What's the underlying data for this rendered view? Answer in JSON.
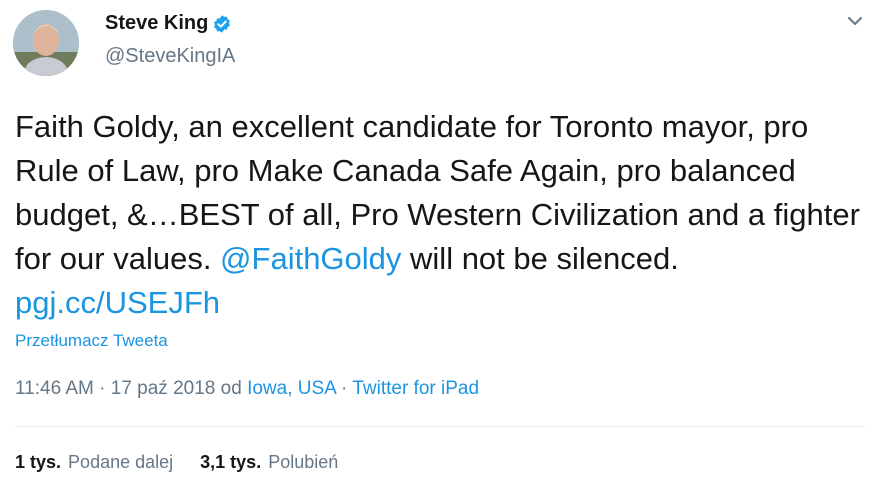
{
  "user": {
    "display_name": "Steve King",
    "handle": "@SteveKingIA",
    "verified": true
  },
  "tweet": {
    "text_main": "Faith Goldy, an excellent candidate for Toronto mayor, pro Rule of Law, pro Make Canada Safe Again, pro balanced budget, &…BEST of all, Pro Western Civilization and a fighter for our values. ",
    "mention": "@FaithGoldy",
    "text_after": " will not be silenced. ",
    "url": "pgj.cc/USEJFh"
  },
  "translate_label": "Przetłumacz Tweeta",
  "meta": {
    "time": "11:46 AM",
    "separator": " · ",
    "date": "17 paź 2018",
    "from_word": " od ",
    "location": "Iowa, USA",
    "source": "Twitter for iPad"
  },
  "stats": {
    "retweets_count": "1 tys.",
    "retweets_label": "Podane dalej",
    "likes_count": "3,1 tys.",
    "likes_label": "Polubień"
  },
  "icons": {
    "verified": "verified-badge-icon",
    "menu": "chevron-down-icon"
  },
  "colors": {
    "link": "#1b95e0",
    "secondary_text": "#657786",
    "primary_text": "#14171a"
  }
}
